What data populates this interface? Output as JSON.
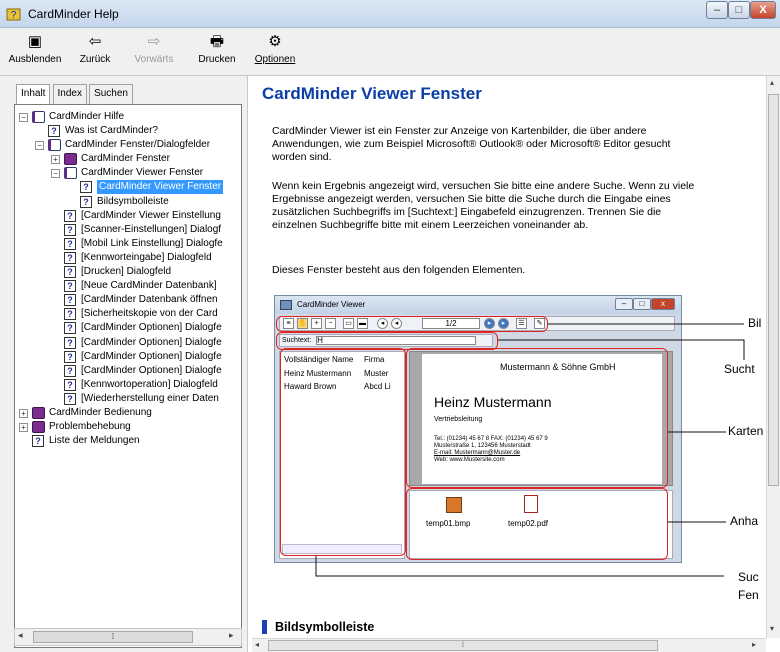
{
  "window": {
    "title": "CardMinder Help",
    "min": "–",
    "max": "□",
    "close": "X"
  },
  "toolbar": {
    "items": [
      {
        "label": "Ausblenden",
        "icon": "hide-pane-icon",
        "glyph": "▣"
      },
      {
        "label": "Zurück",
        "icon": "back-arrow-icon",
        "glyph": "⇦"
      },
      {
        "label": "Vorwärts",
        "icon": "forward-arrow-icon",
        "glyph": "⇨"
      },
      {
        "label": "Drucken",
        "icon": "printer-icon",
        "glyph": "🖶"
      },
      {
        "label": "Optionen",
        "icon": "options-icon",
        "glyph": "⚙"
      }
    ]
  },
  "nav": {
    "tabs": [
      "Inhalt",
      "Index",
      "Suchen"
    ],
    "active_tab": "Inhalt"
  },
  "tree": [
    {
      "label": "CardMinder Hilfe",
      "level": 0,
      "kind": "book-open",
      "expander": "−"
    },
    {
      "label": "Was ist CardMinder?",
      "level": 1,
      "kind": "page"
    },
    {
      "label": "CardMinder Fenster/Dialogfelder",
      "level": 1,
      "kind": "book-open",
      "expander": "−"
    },
    {
      "label": "CardMinder Fenster",
      "level": 2,
      "kind": "book-closed",
      "expander": "+"
    },
    {
      "label": "CardMinder Viewer Fenster",
      "level": 2,
      "kind": "book-open",
      "expander": "−"
    },
    {
      "label": "CardMinder Viewer Fenster",
      "level": 3,
      "kind": "page",
      "selected": true
    },
    {
      "label": "Bildsymbolleiste",
      "level": 3,
      "kind": "page"
    },
    {
      "label": "[CardMinder Viewer Einstellung",
      "level": 2,
      "kind": "page"
    },
    {
      "label": "[Scanner-Einstellungen] Dialogf",
      "level": 2,
      "kind": "page"
    },
    {
      "label": "[Mobil Link Einstellung] Dialogfe",
      "level": 2,
      "kind": "page"
    },
    {
      "label": "[Kennworteingabe] Dialogfeld",
      "level": 2,
      "kind": "page"
    },
    {
      "label": "[Drucken] Dialogfeld",
      "level": 2,
      "kind": "page"
    },
    {
      "label": "[Neue CardMinder Datenbank]",
      "level": 2,
      "kind": "page"
    },
    {
      "label": "[CardMinder Datenbank öffnen",
      "level": 2,
      "kind": "page"
    },
    {
      "label": "[Sicherheitskopie von der Card",
      "level": 2,
      "kind": "page"
    },
    {
      "label": "[CardMinder Optionen] Dialogfe",
      "level": 2,
      "kind": "page"
    },
    {
      "label": "[CardMinder Optionen] Dialogfe",
      "level": 2,
      "kind": "page"
    },
    {
      "label": "[CardMinder Optionen] Dialogfe",
      "level": 2,
      "kind": "page"
    },
    {
      "label": "[CardMinder Optionen] Dialogfe",
      "level": 2,
      "kind": "page"
    },
    {
      "label": "[Kennwortoperation] Dialogfeld",
      "level": 2,
      "kind": "page"
    },
    {
      "label": "[Wiederherstellung einer Daten",
      "level": 2,
      "kind": "page"
    },
    {
      "label": "CardMinder Bedienung",
      "level": 0,
      "kind": "book-closed",
      "expander": "+"
    },
    {
      "label": "Problembehebung",
      "level": 0,
      "kind": "book-closed",
      "expander": "+"
    },
    {
      "label": "Liste der Meldungen",
      "level": 0,
      "kind": "page"
    }
  ],
  "content": {
    "title": "CardMinder Viewer Fenster",
    "p1a": "CardMinder Viewer ist ein Fenster zur Anzeige von Kartenbilder, die über andere",
    "p1b": "Anwendungen, wie zum Beispiel Microsoft® Outlook® oder Microsoft® Editor gesucht",
    "p1c": "worden sind.",
    "p2a": "Wenn kein Ergebnis angezeigt wird, versuchen Sie bitte eine andere Suche. Wenn zu viele",
    "p2b": "Ergebnisse angezeigt werden, versuchen Sie bitte die Suche durch die Eingabe eines",
    "p2c": "zusätzlichen Suchbegriffs im [Suchtext:] Eingabefeld einzugrenzen. Trennen Sie die",
    "p2d": "einzelnen Suchbegriffe bitte mit einem Leerzeichen voneinander ab.",
    "p3": "Dieses Fenster besteht aus den folgenden Elementen.",
    "section": "Bildsymbolleiste"
  },
  "viewer": {
    "title": "CardMinder Viewer",
    "page": "1/2",
    "search_label": "Suchtext:",
    "search_value": "H",
    "col_name": "Vollständiger Name",
    "col_company": "Firma",
    "rows": [
      {
        "name": "Heinz Mustermann",
        "company": "Muster"
      },
      {
        "name": "Haward Brown",
        "company": "Abcd Li"
      }
    ],
    "card": {
      "company": "Mustermann & Söhne GmbH",
      "person": "Heinz Mustermann",
      "dept": "Vertriebsleitung",
      "line1": "Tel.: (01234) 45 67 8 FAX: (01234) 45 67 9",
      "line2": "Musterstraße 1, 123456 Musterstadt",
      "line3": "E-mail: Mustermann@Muster.de",
      "line4": "Web: www.Mustersite.com"
    },
    "attachments": [
      "temp01.bmp",
      "temp02.pdf"
    ]
  },
  "callouts": [
    "Bil",
    "Sucht",
    "Karten",
    "Anha",
    "Suc",
    "Fen"
  ],
  "colors": {
    "heading": "#0b3ea8",
    "highlight": "#e02424",
    "selection": "#3399ff"
  }
}
